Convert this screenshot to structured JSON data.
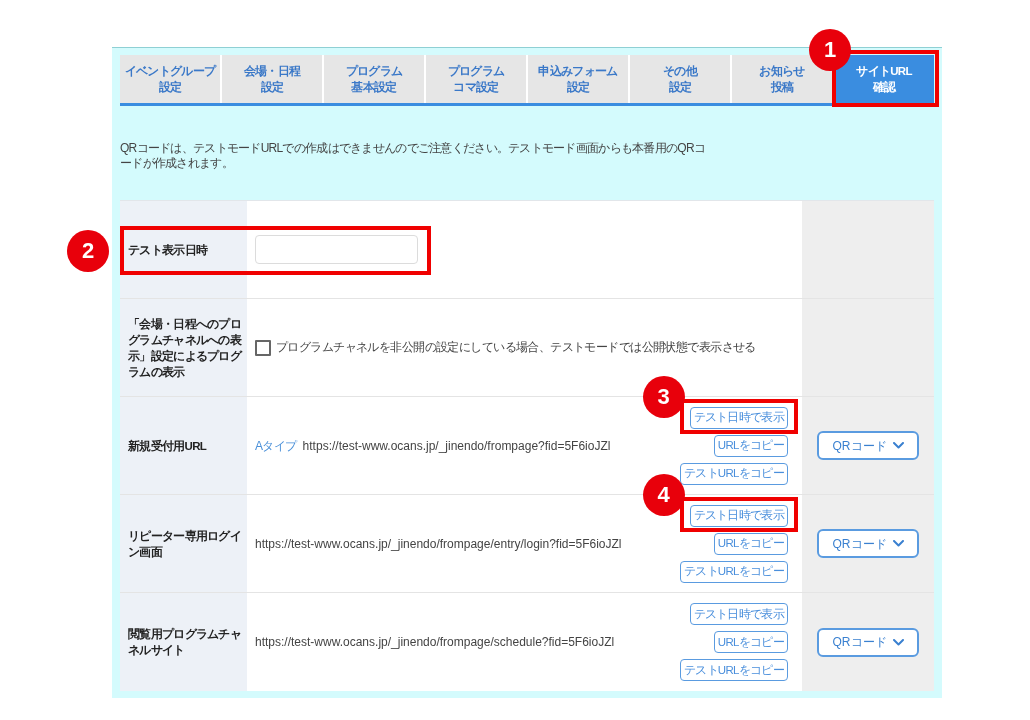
{
  "tabs": [
    {
      "lines": [
        "イベントグループ",
        "設定"
      ],
      "selected": false
    },
    {
      "lines": [
        "会場・日程",
        "設定"
      ],
      "selected": false
    },
    {
      "lines": [
        "プログラム",
        "基本設定"
      ],
      "selected": false
    },
    {
      "lines": [
        "プログラム",
        "コマ設定"
      ],
      "selected": false
    },
    {
      "lines": [
        "申込みフォーム",
        "設定"
      ],
      "selected": false
    },
    {
      "lines": [
        "その他",
        "設定"
      ],
      "selected": false
    },
    {
      "lines": [
        "お知らせ",
        "投稿"
      ],
      "selected": false
    },
    {
      "lines": [
        "サイトURL",
        "確認"
      ],
      "selected": true,
      "callout": "1"
    }
  ],
  "notice": "QRコードは、テストモードURLでの作成はできませんのでご注意ください。テストモード画面からも本番用のQRコードが作成されます。",
  "rows": [
    {
      "kind": "datetime",
      "label": "テスト表示日時",
      "callout": "2"
    },
    {
      "kind": "checkbox",
      "label": "「会場・日程へのプログラムチャネルへの表示」設定によるプログラムの表示",
      "checkbox": {
        "label": "プログラムチャネルを非公開の設定にしている場合、テストモードでは公開状態で表示させる",
        "checked": false
      }
    },
    {
      "kind": "url",
      "label": "新規受付用URL",
      "type_link": "Aタイプ",
      "url": "https://test-www.ocans.jp/_jinendo/frompage?fid=5F6ioJZl",
      "buttons": [
        {
          "label": "テスト日時で表示",
          "callout": "3"
        },
        {
          "label": "URLをコピー"
        },
        {
          "label": "テストURLをコピー"
        }
      ],
      "qr_button": "QRコード"
    },
    {
      "kind": "url",
      "label": "リピーター専用ログイン画面",
      "url": "https://test-www.ocans.jp/_jinendo/frompage/entry/login?fid=5F6ioJZl",
      "buttons": [
        {
          "label": "テスト日時で表示",
          "callout": "4"
        },
        {
          "label": "URLをコピー"
        },
        {
          "label": "テストURLをコピー"
        }
      ],
      "qr_button": "QRコード"
    },
    {
      "kind": "url",
      "label": "閲覧用プログラムチャネルサイト",
      "url": "https://test-www.ocans.jp/_jinendo/frompage/schedule?fid=5F6ioJZl",
      "buttons": [
        {
          "label": "テスト日時で表示"
        },
        {
          "label": "URLをコピー"
        },
        {
          "label": "テストURLをコピー"
        }
      ],
      "qr_button": "QRコード"
    }
  ]
}
